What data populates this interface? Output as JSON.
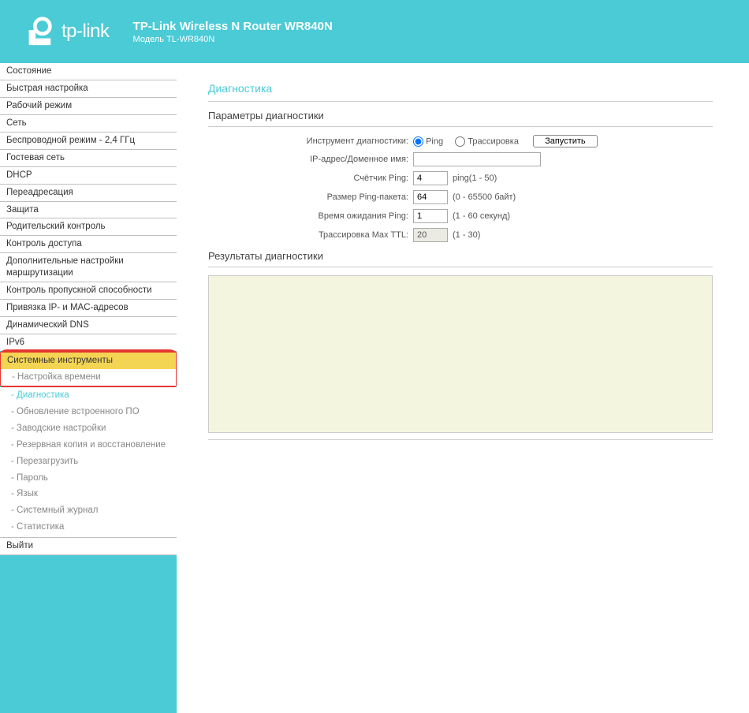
{
  "header": {
    "brand": "tp-link",
    "title": "TP-Link Wireless N Router WR840N",
    "subtitle": "Модель TL-WR840N"
  },
  "sidebar": {
    "items": [
      "Состояние",
      "Быстрая настройка",
      "Рабочий режим",
      "Сеть",
      "Беспроводной режим - 2,4 ГГц",
      "Гостевая сеть",
      "DHCP",
      "Переадресация",
      "Защита",
      "Родительский контроль",
      "Контроль доступа",
      "Дополнительные настройки маршрутизации",
      "Контроль пропускной способности",
      "Привязка IP- и MAC-адресов",
      "Динамический DNS",
      "IPv6"
    ],
    "active": "Системные инструменты",
    "sub": [
      "- Настройка времени",
      "- Диагностика",
      "- Обновление встроенного ПО",
      "- Заводские настройки",
      "- Резервная копия и восстановление",
      "- Перезагрузить",
      "- Пароль",
      "- Язык",
      "- Системный журнал",
      "- Статистика"
    ],
    "exit": "Выйти"
  },
  "page": {
    "title": "Диагностика",
    "params_title": "Параметры диагностики",
    "results_title": "Результаты диагностики",
    "labels": {
      "tool": "Инструмент диагностики:",
      "ip": "IP-адрес/Доменное имя:",
      "ping_count": "Счётчик Ping:",
      "ping_size": "Размер Ping-пакета:",
      "ping_timeout": "Время ожидания Ping:",
      "trace_ttl": "Трассировка Max TTL:"
    },
    "radios": {
      "ping": "Ping",
      "trace": "Трассировка"
    },
    "run_btn": "Запустить",
    "values": {
      "ping_count": "4",
      "ping_size": "64",
      "ping_timeout": "1",
      "trace_ttl": "20",
      "ip": ""
    },
    "hints": {
      "ping_count": "ping(1 - 50)",
      "ping_size": "(0 - 65500 байт)",
      "ping_timeout": "(1 - 60 секунд)",
      "trace_ttl": "(1 - 30)"
    }
  }
}
